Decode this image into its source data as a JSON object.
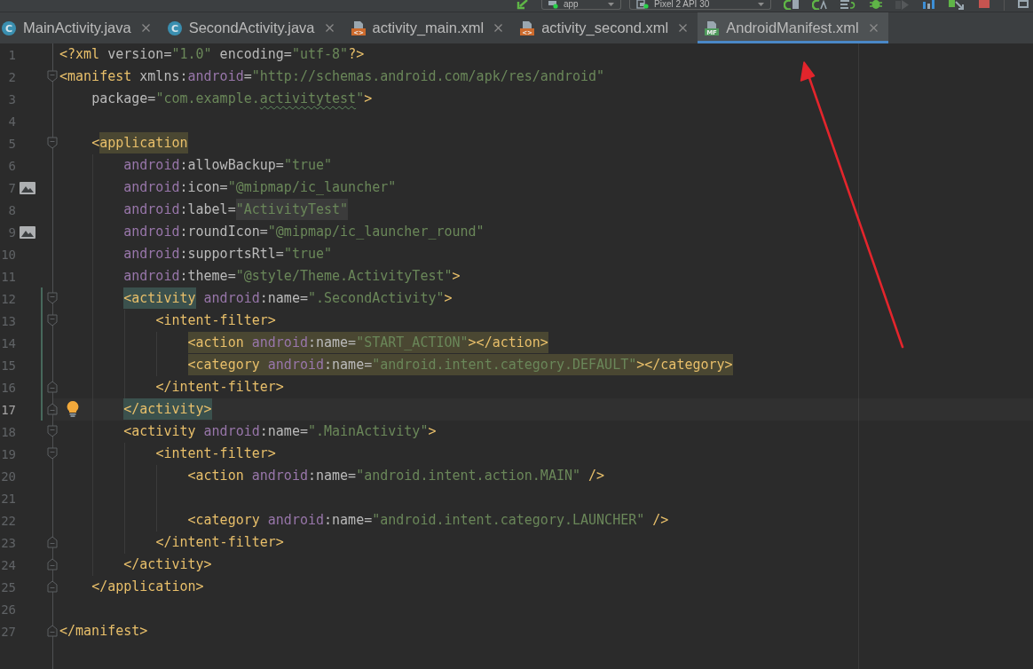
{
  "toolbar": {
    "configurations": [
      {
        "label": "app",
        "kind": "module"
      },
      {
        "label": "Pixel 2 API 30",
        "kind": "device"
      }
    ]
  },
  "tabs": [
    {
      "label": "MainActivity.java",
      "kind": "class",
      "icon_text": "C",
      "selected": false
    },
    {
      "label": "SecondActivity.java",
      "kind": "class",
      "icon_text": "C",
      "selected": false
    },
    {
      "label": "activity_main.xml",
      "kind": "layout",
      "icon_text": "<>",
      "selected": false
    },
    {
      "label": "activity_second.xml",
      "kind": "layout",
      "icon_text": "<>",
      "selected": false
    },
    {
      "label": "AndroidManifest.xml",
      "kind": "manifest",
      "icon_text": "MF",
      "selected": true
    }
  ],
  "editor": {
    "lines": [
      {
        "number": "1",
        "current": false,
        "changed": false,
        "tokens": [
          {
            "text": "<?xml",
            "kind": "tag"
          },
          {
            "text": " version=",
            "kind": "attr"
          },
          {
            "text": "\"1.0\"",
            "kind": "value"
          },
          {
            "text": " encoding=",
            "kind": "attr"
          },
          {
            "text": "\"utf-8\"",
            "kind": "value"
          },
          {
            "text": "?>",
            "kind": "tag"
          }
        ]
      },
      {
        "number": "2",
        "current": false,
        "changed": false,
        "markers": [
          {
            "kind": "fold_start"
          }
        ],
        "tokens": [
          {
            "text": "<manifest",
            "kind": "tag"
          },
          {
            "text": " xmlns:",
            "kind": "attr"
          },
          {
            "text": "android",
            "kind": "ns"
          },
          {
            "text": "=",
            "kind": "attr"
          },
          {
            "text": "\"http://schemas.android.com/apk/res/android\"",
            "kind": "value"
          }
        ]
      },
      {
        "number": "3",
        "current": false,
        "changed": false,
        "tokens": [
          {
            "text": "    package=",
            "kind": "attr"
          },
          {
            "text": "\"com.example.",
            "kind": "value"
          },
          {
            "text": "activitytest",
            "kind": "value",
            "highlight": {
              "kind": "typo"
            }
          },
          {
            "text": "\"",
            "kind": "value"
          },
          {
            "text": ">",
            "kind": "tag"
          }
        ]
      },
      {
        "number": "4",
        "current": false,
        "changed": false
      },
      {
        "number": "5",
        "current": false,
        "changed": false,
        "markers": [
          {
            "kind": "fold_start"
          }
        ],
        "tokens": [
          {
            "text": "    <",
            "kind": "tag"
          },
          {
            "text": "application",
            "kind": "tag",
            "highlight": {
              "kind": "usage"
            }
          }
        ]
      },
      {
        "number": "6",
        "current": false,
        "changed": false,
        "tokens": [
          {
            "text": "        android",
            "kind": "ns"
          },
          {
            "text": ":allowBackup=",
            "kind": "attr"
          },
          {
            "text": "\"true\"",
            "kind": "value"
          }
        ]
      },
      {
        "number": "7",
        "current": false,
        "changed": false,
        "markers": [
          {
            "kind": "image"
          }
        ],
        "tokens": [
          {
            "text": "        android",
            "kind": "ns"
          },
          {
            "text": ":icon=",
            "kind": "attr"
          },
          {
            "text": "\"@mipmap/ic_launcher\"",
            "kind": "value"
          }
        ]
      },
      {
        "number": "8",
        "current": false,
        "changed": false,
        "tokens": [
          {
            "text": "        android",
            "kind": "ns"
          },
          {
            "text": ":label=",
            "kind": "attr"
          },
          {
            "text": "\"ActivityTest\"",
            "kind": "value",
            "highlight": {
              "kind": "occurrence"
            }
          }
        ]
      },
      {
        "number": "9",
        "current": false,
        "changed": false,
        "markers": [
          {
            "kind": "image"
          }
        ],
        "tokens": [
          {
            "text": "        android",
            "kind": "ns"
          },
          {
            "text": ":roundIcon=",
            "kind": "attr"
          },
          {
            "text": "\"@mipmap/ic_launcher_round\"",
            "kind": "value"
          }
        ]
      },
      {
        "number": "10",
        "current": false,
        "changed": false,
        "tokens": [
          {
            "text": "        android",
            "kind": "ns"
          },
          {
            "text": ":supportsRtl=",
            "kind": "attr"
          },
          {
            "text": "\"true\"",
            "kind": "value"
          }
        ]
      },
      {
        "number": "11",
        "current": false,
        "changed": false,
        "tokens": [
          {
            "text": "        android",
            "kind": "ns"
          },
          {
            "text": ":theme=",
            "kind": "attr"
          },
          {
            "text": "\"@style/Theme.ActivityTest\"",
            "kind": "value"
          },
          {
            "text": ">",
            "kind": "tag"
          }
        ]
      },
      {
        "number": "12",
        "current": false,
        "changed": true,
        "markers": [
          {
            "kind": "fold_start"
          }
        ],
        "tokens": [
          {
            "text": "        <activity",
            "kind": "tag",
            "highlight": {
              "kind": "match"
            }
          },
          {
            "text": " android",
            "kind": "ns"
          },
          {
            "text": ":name=",
            "kind": "attr"
          },
          {
            "text": "\".SecondActivity\"",
            "kind": "value"
          },
          {
            "text": ">",
            "kind": "tag"
          }
        ]
      },
      {
        "number": "13",
        "current": false,
        "changed": true,
        "markers": [
          {
            "kind": "fold_start"
          }
        ],
        "tokens": [
          {
            "text": "            <intent-filter>",
            "kind": "tag"
          }
        ]
      },
      {
        "number": "14",
        "current": false,
        "changed": true,
        "tokens": [
          {
            "text": "                <action",
            "kind": "tag",
            "highlight": {
              "kind": "usage"
            }
          },
          {
            "text": " android",
            "kind": "ns",
            "highlight": {
              "kind": "usage"
            }
          },
          {
            "text": ":name=",
            "kind": "attr",
            "highlight": {
              "kind": "usage"
            }
          },
          {
            "text": "\"START_ACTION\"",
            "kind": "value",
            "highlight": {
              "kind": "usage"
            }
          },
          {
            "text": "></action>",
            "kind": "tag",
            "highlight": {
              "kind": "usage"
            }
          }
        ]
      },
      {
        "number": "15",
        "current": false,
        "changed": true,
        "tokens": [
          {
            "text": "                <category",
            "kind": "tag",
            "highlight": {
              "kind": "usage"
            }
          },
          {
            "text": " android",
            "kind": "ns",
            "highlight": {
              "kind": "usage"
            }
          },
          {
            "text": ":name=",
            "kind": "attr",
            "highlight": {
              "kind": "usage"
            }
          },
          {
            "text": "\"android.intent.category.DEFAULT\"",
            "kind": "value",
            "highlight": {
              "kind": "usage"
            }
          },
          {
            "text": "></category>",
            "kind": "tag",
            "highlight": {
              "kind": "usage"
            }
          }
        ]
      },
      {
        "number": "16",
        "current": false,
        "changed": true,
        "markers": [
          {
            "kind": "fold_end"
          }
        ],
        "tokens": [
          {
            "text": "            </intent-filter>",
            "kind": "tag"
          }
        ]
      },
      {
        "number": "17",
        "current": true,
        "changed": true,
        "markers": [
          {
            "kind": "fold_end"
          },
          {
            "kind": "bulb"
          }
        ],
        "tokens": [
          {
            "text": "        </activity>",
            "kind": "tag",
            "highlight": {
              "kind": "match"
            }
          }
        ]
      },
      {
        "number": "18",
        "current": false,
        "changed": false,
        "markers": [
          {
            "kind": "fold_start"
          }
        ],
        "tokens": [
          {
            "text": "        <activity",
            "kind": "tag"
          },
          {
            "text": " android",
            "kind": "ns"
          },
          {
            "text": ":name=",
            "kind": "attr"
          },
          {
            "text": "\".MainActivity\"",
            "kind": "value"
          },
          {
            "text": ">",
            "kind": "tag"
          }
        ]
      },
      {
        "number": "19",
        "current": false,
        "changed": false,
        "markers": [
          {
            "kind": "fold_start"
          }
        ],
        "tokens": [
          {
            "text": "            <intent-filter>",
            "kind": "tag"
          }
        ]
      },
      {
        "number": "20",
        "current": false,
        "changed": false,
        "tokens": [
          {
            "text": "                <action",
            "kind": "tag"
          },
          {
            "text": " android",
            "kind": "ns"
          },
          {
            "text": ":name=",
            "kind": "attr"
          },
          {
            "text": "\"android.intent.action.MAIN\"",
            "kind": "value"
          },
          {
            "text": " />",
            "kind": "tag"
          }
        ]
      },
      {
        "number": "21",
        "current": false,
        "changed": false
      },
      {
        "number": "22",
        "current": false,
        "changed": false,
        "tokens": [
          {
            "text": "                <category",
            "kind": "tag"
          },
          {
            "text": " android",
            "kind": "ns"
          },
          {
            "text": ":name=",
            "kind": "attr"
          },
          {
            "text": "\"android.intent.category.LAUNCHER\"",
            "kind": "value"
          },
          {
            "text": " />",
            "kind": "tag"
          }
        ]
      },
      {
        "number": "23",
        "current": false,
        "changed": false,
        "markers": [
          {
            "kind": "fold_end"
          }
        ],
        "tokens": [
          {
            "text": "            </intent-filter>",
            "kind": "tag"
          }
        ]
      },
      {
        "number": "24",
        "current": false,
        "changed": false,
        "markers": [
          {
            "kind": "fold_end"
          }
        ],
        "tokens": [
          {
            "text": "        </activity>",
            "kind": "tag"
          }
        ]
      },
      {
        "number": "25",
        "current": false,
        "changed": false,
        "markers": [
          {
            "kind": "fold_end"
          }
        ],
        "tokens": [
          {
            "text": "    </application>",
            "kind": "tag"
          }
        ]
      },
      {
        "number": "26",
        "current": false,
        "changed": false
      },
      {
        "number": "27",
        "current": false,
        "changed": false,
        "markers": [
          {
            "kind": "fold_end"
          }
        ],
        "tokens": [
          {
            "text": "</manifest>",
            "kind": "tag"
          }
        ]
      }
    ]
  },
  "annotations": [
    {
      "kind": "arrow"
    }
  ]
}
